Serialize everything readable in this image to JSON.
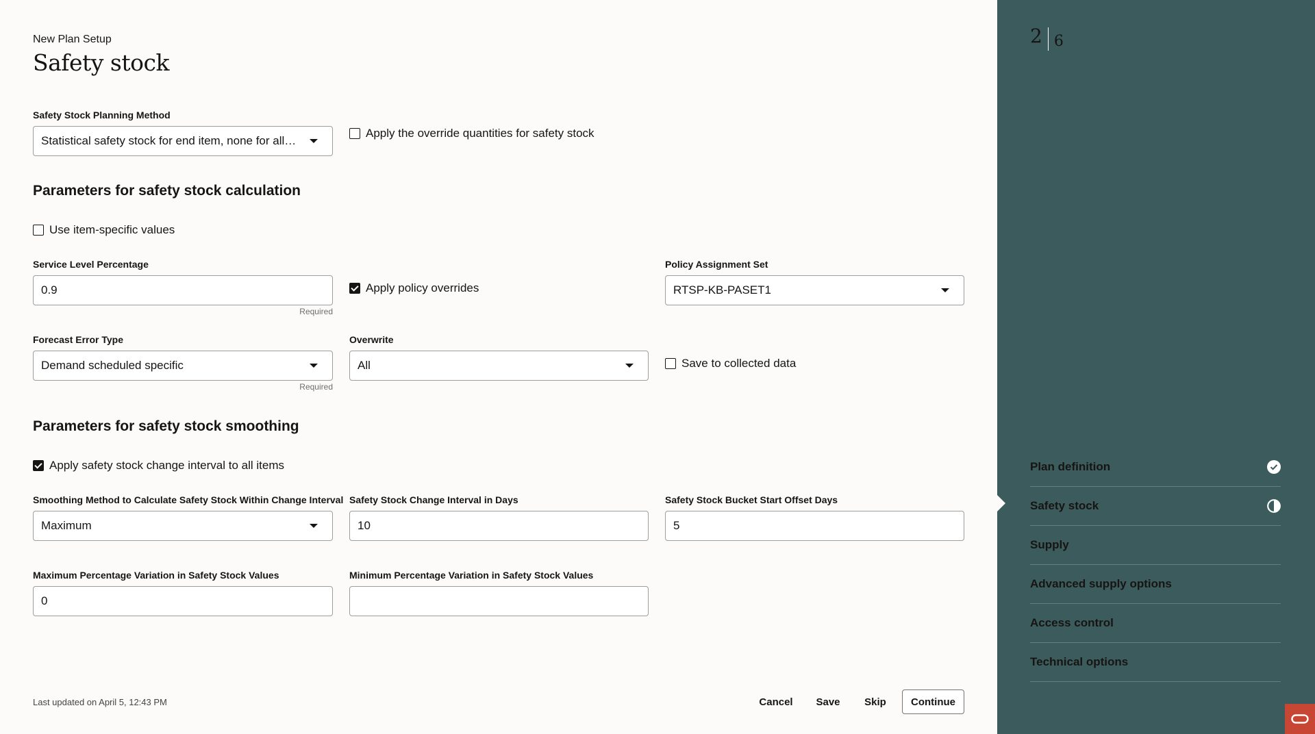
{
  "header": {
    "breadcrumb": "New Plan Setup",
    "title": "Safety stock"
  },
  "planning_method": {
    "label": "Safety Stock Planning Method",
    "value": "Statistical safety stock for end item, none for all o…",
    "override_checkbox": {
      "label": "Apply the override quantities for safety stock",
      "checked": false
    }
  },
  "calc_section": {
    "title": "Parameters for safety stock calculation",
    "item_specific": {
      "label": "Use item-specific values",
      "checked": false
    },
    "service_level": {
      "label": "Service Level Percentage",
      "value": "0.9",
      "hint": "Required"
    },
    "policy_overrides": {
      "label": "Apply policy overrides",
      "checked": true
    },
    "policy_assignment": {
      "label": "Policy Assignment Set",
      "value": "RTSP-KB-PASET1"
    },
    "forecast_error": {
      "label": "Forecast Error Type",
      "value": "Demand scheduled specific",
      "hint": "Required"
    },
    "overwrite": {
      "label": "Overwrite",
      "value": "All"
    },
    "save_collected": {
      "label": "Save to collected data",
      "checked": false
    }
  },
  "smoothing_section": {
    "title": "Parameters for safety stock smoothing",
    "apply_interval": {
      "label": "Apply safety stock change interval to all items",
      "checked": true
    },
    "smoothing_method": {
      "label": "Smoothing Method to Calculate Safety Stock Within Change Interval",
      "value": "Maximum"
    },
    "change_interval": {
      "label": "Safety Stock Change Interval in Days",
      "value": "10"
    },
    "bucket_offset": {
      "label": "Safety Stock Bucket Start Offset Days",
      "value": "5"
    },
    "max_variation": {
      "label": "Maximum Percentage Variation in Safety Stock Values",
      "value": "0"
    },
    "min_variation": {
      "label": "Minimum Percentage Variation in Safety Stock Values",
      "value": ""
    }
  },
  "footer": {
    "last_updated": "Last updated on April 5, 12:43 PM",
    "cancel": "Cancel",
    "save": "Save",
    "skip": "Skip",
    "continue": "Continue"
  },
  "progress": {
    "current": "2",
    "total": "6"
  },
  "steps": [
    {
      "label": "Plan definition",
      "status": "complete"
    },
    {
      "label": "Safety stock",
      "status": "in-progress"
    },
    {
      "label": "Supply",
      "status": "pending"
    },
    {
      "label": "Advanced supply options",
      "status": "pending"
    },
    {
      "label": "Access control",
      "status": "pending"
    },
    {
      "label": "Technical options",
      "status": "pending"
    }
  ],
  "colors": {
    "sidebar_bg": "#3c5b5c",
    "page_bg": "#fcfbfa",
    "oracle_red": "#c74634"
  }
}
